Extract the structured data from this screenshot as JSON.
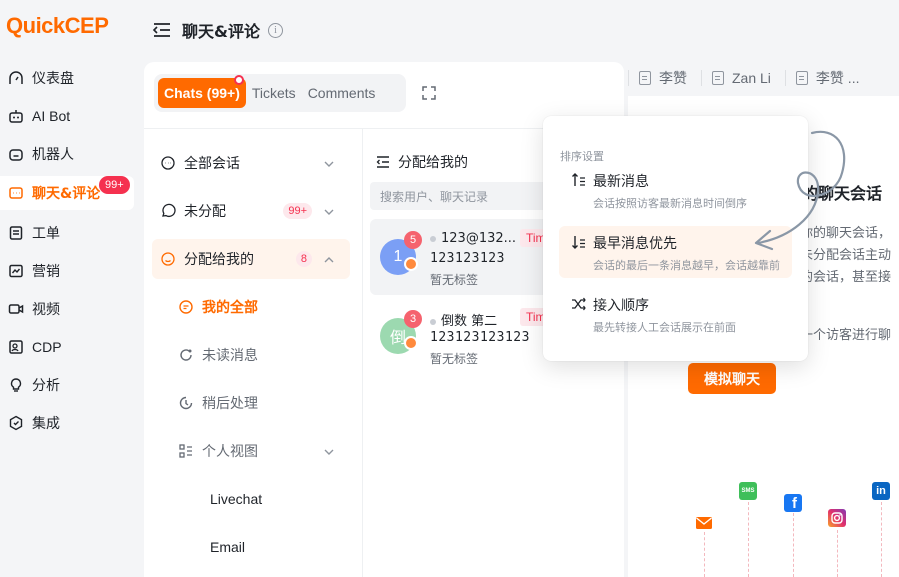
{
  "brand": {
    "logo_q": "Q",
    "logo_uick": "uick",
    "logo_cep": "CEP"
  },
  "nav": {
    "items": [
      {
        "label": "仪表盘",
        "icon": "dashboard-icon"
      },
      {
        "label": "AI Bot",
        "icon": "bot-icon"
      },
      {
        "label": "机器人",
        "icon": "robot-icon"
      },
      {
        "label": "聊天&评论",
        "icon": "chat-icon",
        "active": true,
        "badge": "99+"
      },
      {
        "label": "工单",
        "icon": "ticket-icon"
      },
      {
        "label": "营销",
        "icon": "marketing-icon"
      },
      {
        "label": "视频",
        "icon": "video-icon"
      },
      {
        "label": "CDP",
        "icon": "cdp-icon"
      },
      {
        "label": "分析",
        "icon": "analytics-icon"
      },
      {
        "label": "集成",
        "icon": "integration-icon"
      }
    ]
  },
  "header": {
    "title": "聊天&评论",
    "info": "i"
  },
  "tabs": {
    "chats": "Chats (99+)",
    "tickets": "Tickets",
    "comments": "Comments"
  },
  "menu": {
    "all": "全部会话",
    "unassigned": "未分配",
    "unassigned_count": "99+",
    "assigned": "分配给我的",
    "assigned_count": "8",
    "my_all": "我的全部",
    "unread": "未读消息",
    "later": "稍后处理",
    "personal_view": "个人视图",
    "livechat": "Livechat",
    "email": "Email"
  },
  "list": {
    "header": "分配给我的",
    "search_placeholder": "搜索用户、聊天记录",
    "chats": [
      {
        "avatar": "1",
        "unread": "5",
        "name": "123@132...",
        "tag": "Tim",
        "message": "123123123",
        "label": "暂无标签"
      },
      {
        "avatar": "倒",
        "unread": "3",
        "name": "倒数 第二",
        "tag": "Tim",
        "message": "123123123123",
        "label": "暂无标签"
      }
    ]
  },
  "right": {
    "tabs": [
      "李赞",
      "Zan Li",
      "李赞 ..."
    ],
    "title": "的聊天会话",
    "lines": [
      "你的聊天会话，",
      "未分配会话主动",
      "的会话，甚至接",
      "一个访客进行聊"
    ],
    "button": "模拟聊天"
  },
  "popover": {
    "title": "排序设置",
    "options": [
      {
        "label": "最新消息",
        "desc": "会话按照访客最新消息时间倒序"
      },
      {
        "label": "最早消息优先",
        "desc": "会话的最后一条消息越早，会话越靠前",
        "selected": true
      },
      {
        "label": "接入顺序",
        "desc": "最先转接人工会话展示在前面"
      }
    ]
  },
  "channels": {
    "sms": "SMS",
    "facebook": "f",
    "linkedin": "in"
  },
  "colors": {
    "accent": "#ff6a00",
    "badge": "#f5314f",
    "selected_bg": "#fff4ec"
  }
}
